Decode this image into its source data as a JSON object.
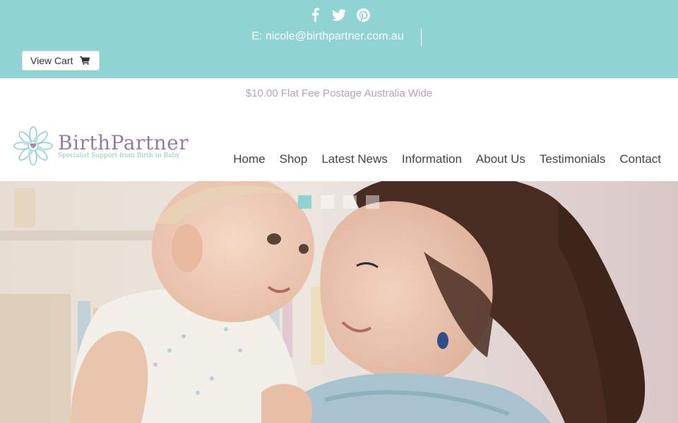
{
  "topbar": {
    "social": [
      {
        "icon": "facebook-icon"
      },
      {
        "icon": "twitter-icon"
      },
      {
        "icon": "pinterest-icon"
      }
    ],
    "email_prefix": "E:",
    "email": "nicole@birthpartner.com.au",
    "view_cart_label": "View Cart",
    "cart_icon": "cart-icon"
  },
  "postage_notice": "$10.00 Flat Fee Postage Australia Wide",
  "logo": {
    "name": "BirthPartner",
    "tagline": "Specialist Support from Birth to Baby"
  },
  "nav": {
    "items": [
      "Home",
      "Shop",
      "Latest News",
      "Information",
      "About Us",
      "Testimonials",
      "Contact"
    ]
  },
  "slider": {
    "slide_count": 4,
    "active_index": 0
  },
  "colors": {
    "accent": "#8fd3d2",
    "brand_purple": "#8f7ea6",
    "postage_text": "#b49fbe",
    "nav_text": "#444444"
  }
}
